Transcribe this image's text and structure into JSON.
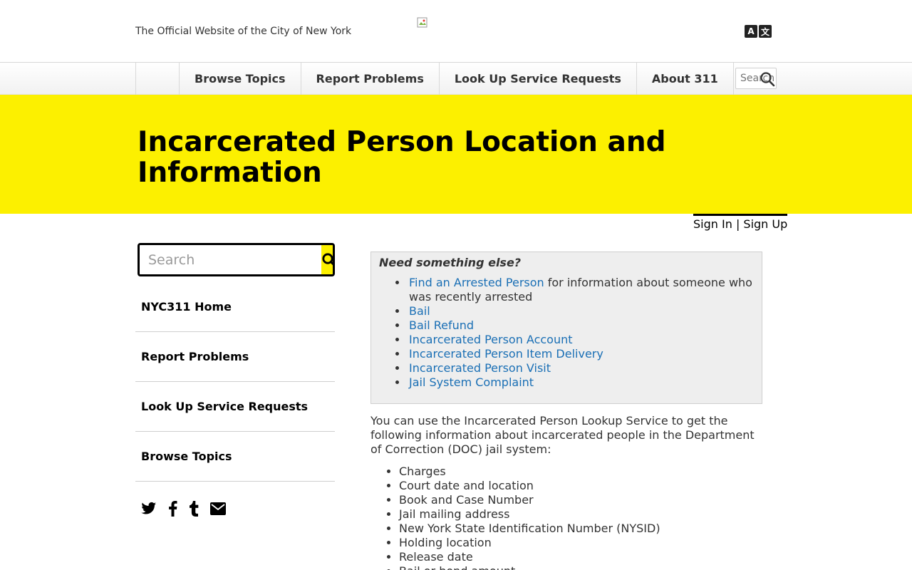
{
  "header": {
    "official_text": "The Official Website of the City of New York",
    "translate_icon": "translate-icon"
  },
  "nav": {
    "items": [
      {
        "label": "Browse Topics"
      },
      {
        "label": "Report Problems"
      },
      {
        "label": "Look Up Service Requests"
      },
      {
        "label": "About 311"
      }
    ],
    "search_placeholder": "Search",
    "search_icon": "search-icon"
  },
  "hero": {
    "title": "Incarcerated Person Location and Information"
  },
  "account": {
    "sign_in": "Sign In",
    "separator": "|",
    "sign_up": "Sign Up"
  },
  "sidebar": {
    "search_placeholder": "Search",
    "items": [
      {
        "label": "NYC311 Home"
      },
      {
        "label": "Report Problems"
      },
      {
        "label": "Look Up Service Requests"
      },
      {
        "label": "Browse Topics"
      }
    ],
    "social": [
      "twitter-icon",
      "facebook-icon",
      "tumblr-icon",
      "email-icon"
    ]
  },
  "need_box": {
    "heading": "Need something else?",
    "links": [
      {
        "label": "Find an Arrested Person",
        "suffix": " for information about someone who was recently arrested"
      },
      {
        "label": "Bail",
        "suffix": ""
      },
      {
        "label": "Bail Refund",
        "suffix": ""
      },
      {
        "label": "Incarcerated Person Account",
        "suffix": ""
      },
      {
        "label": "Incarcerated Person Item Delivery",
        "suffix": ""
      },
      {
        "label": "Incarcerated Person Visit",
        "suffix": ""
      },
      {
        "label": "Jail System Complaint",
        "suffix": ""
      }
    ]
  },
  "content": {
    "intro": "You can use the Incarcerated Person Lookup Service to get the following information about incarcerated people in the Department of Correction (DOC) jail system:",
    "info_items": [
      "Charges",
      "Court date and location",
      "Book and Case Number",
      "Jail mailing address",
      "New York State Identification Number (NYSID)",
      "Holding location",
      "Release date",
      "Bail or bond amount"
    ]
  },
  "colors": {
    "accent_yellow": "#fcf000",
    "link_blue": "#1a6fb5",
    "box_bg": "#eeeeee"
  }
}
